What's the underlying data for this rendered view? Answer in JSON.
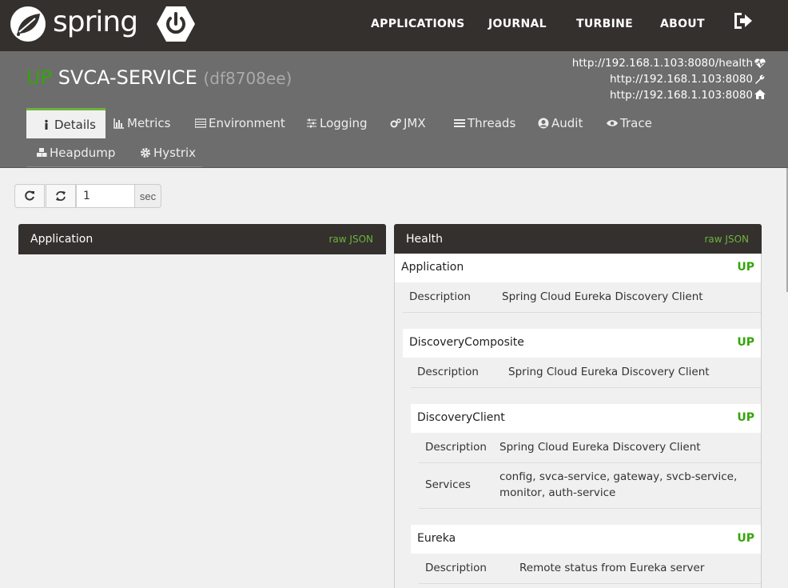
{
  "brand": {
    "name": "spring"
  },
  "nav": {
    "items": [
      "APPLICATIONS",
      "JOURNAL",
      "TURBINE",
      "ABOUT"
    ]
  },
  "app": {
    "status": "UP",
    "name": "SVCA-SERVICE",
    "id": "(df8708ee)",
    "urls": [
      "http://192.168.1.103:8080/health",
      "http://192.168.1.103:8080",
      "http://192.168.1.103:8080"
    ],
    "url_icons": [
      "heartbeat-icon",
      "wrench-icon",
      "home-icon"
    ]
  },
  "tabs": [
    {
      "label": "Details",
      "icon": "info-icon"
    },
    {
      "label": "Metrics",
      "icon": "bar-chart-icon"
    },
    {
      "label": "Environment",
      "icon": "list-icon"
    },
    {
      "label": "Logging",
      "icon": "sliders-icon"
    },
    {
      "label": "JMX",
      "icon": "cogs-icon"
    },
    {
      "label": "Threads",
      "icon": "align-justify-icon"
    },
    {
      "label": "Audit",
      "icon": "user-circle-icon"
    },
    {
      "label": "Trace",
      "icon": "eye-icon"
    },
    {
      "label": "Heapdump",
      "icon": "cubes-icon"
    },
    {
      "label": "Hystrix",
      "icon": "gear-icon"
    }
  ],
  "toolbar": {
    "refresh_interval": "1",
    "interval_unit": "sec"
  },
  "panels": {
    "application": {
      "title": "Application",
      "raw_link": "raw JSON"
    },
    "health": {
      "title": "Health",
      "raw_link": "raw JSON"
    }
  },
  "health": {
    "application": {
      "label": "Application",
      "status": "UP",
      "description_key": "Description",
      "description": "Spring Cloud Eureka Discovery Client"
    },
    "discovery_composite": {
      "label": "DiscoveryComposite",
      "status": "UP",
      "description_key": "Description",
      "description": "Spring Cloud Eureka Discovery Client"
    },
    "discovery_client": {
      "label": "DiscoveryClient",
      "status": "UP",
      "description_key": "Description",
      "description": "Spring Cloud Eureka Discovery Client",
      "services_key": "Services",
      "services_line1": "config, svca-service, gateway, svcb-service,",
      "services_line2": "monitor, auth-service"
    },
    "eureka": {
      "label": "Eureka",
      "status": "UP",
      "description_key": "Description",
      "description": "Remote status from Eureka server"
    }
  },
  "colors": {
    "navbar": "#34302d",
    "header": "#6d6d6d",
    "up_green": "#34a40a",
    "accent": "#6db33f"
  }
}
